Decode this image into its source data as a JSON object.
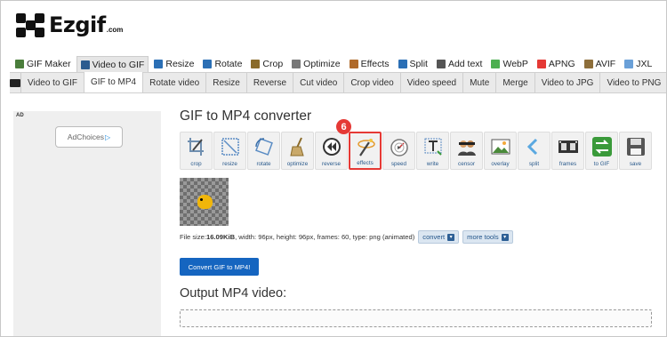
{
  "logo": {
    "name": "Ezgif",
    "domain": ".com"
  },
  "tool_nav": [
    {
      "label": "GIF Maker",
      "icon": "gif-maker-icon",
      "color": "#4a7d3b",
      "active": false
    },
    {
      "label": "Video to GIF",
      "icon": "video-icon",
      "color": "#2b5b8f",
      "active": true
    },
    {
      "label": "Resize",
      "icon": "resize-icon",
      "color": "#2b6fb5",
      "active": false
    },
    {
      "label": "Rotate",
      "icon": "rotate-icon",
      "color": "#2b6fb5",
      "active": false
    },
    {
      "label": "Crop",
      "icon": "crop-icon",
      "color": "#8a6b2a",
      "active": false
    },
    {
      "label": "Optimize",
      "icon": "optimize-icon",
      "color": "#777777",
      "active": false
    },
    {
      "label": "Effects",
      "icon": "effects-icon",
      "color": "#b06a2a",
      "active": false
    },
    {
      "label": "Split",
      "icon": "split-icon",
      "color": "#2b6fb5",
      "active": false
    },
    {
      "label": "Add text",
      "icon": "text-icon",
      "color": "#555555",
      "active": false
    },
    {
      "label": "WebP",
      "icon": "webp-icon",
      "color": "#4caf50",
      "active": false
    },
    {
      "label": "APNG",
      "icon": "apng-icon",
      "color": "#e53935",
      "active": false
    },
    {
      "label": "AVIF",
      "icon": "avif-icon",
      "color": "#8d6e3a",
      "active": false
    },
    {
      "label": "JXL",
      "icon": "jxl-icon",
      "color": "#6aa0d8",
      "active": false
    }
  ],
  "sub_tabs": [
    {
      "label": "Video to GIF",
      "active": false
    },
    {
      "label": "GIF to MP4",
      "active": true
    },
    {
      "label": "Rotate video",
      "active": false
    },
    {
      "label": "Resize",
      "active": false
    },
    {
      "label": "Reverse",
      "active": false
    },
    {
      "label": "Cut video",
      "active": false
    },
    {
      "label": "Crop video",
      "active": false
    },
    {
      "label": "Video speed",
      "active": false
    },
    {
      "label": "Mute",
      "active": false
    },
    {
      "label": "Merge",
      "active": false
    },
    {
      "label": "Video to JPG",
      "active": false
    },
    {
      "label": "Video to PNG",
      "active": false
    }
  ],
  "ad": {
    "label": "AD",
    "choices": "AdChoices",
    "choices_icon": "▷"
  },
  "main": {
    "title": "GIF to MP4 converter",
    "tools": [
      {
        "label": "crop",
        "icon": "crop-icon",
        "highlight": false
      },
      {
        "label": "resize",
        "icon": "resize-icon",
        "highlight": false
      },
      {
        "label": "rotate",
        "icon": "rotate-icon",
        "highlight": false
      },
      {
        "label": "optimize",
        "icon": "broom-icon",
        "highlight": false
      },
      {
        "label": "reverse",
        "icon": "rewind-icon",
        "highlight": false
      },
      {
        "label": "effects",
        "icon": "magic-wand-icon",
        "highlight": true
      },
      {
        "label": "speed",
        "icon": "speedometer-icon",
        "highlight": false
      },
      {
        "label": "write",
        "icon": "text-icon",
        "highlight": false
      },
      {
        "label": "censor",
        "icon": "censor-icon",
        "highlight": false
      },
      {
        "label": "overlay",
        "icon": "picture-icon",
        "highlight": false
      },
      {
        "label": "split",
        "icon": "split-icon",
        "highlight": false
      },
      {
        "label": "frames",
        "icon": "film-strip-icon",
        "highlight": false
      },
      {
        "label": "to GIF",
        "icon": "convert-arrows-icon",
        "highlight": false
      },
      {
        "label": "save",
        "icon": "floppy-disk-icon",
        "highlight": false
      }
    ],
    "step_badge": "6",
    "file_info": {
      "prefix": "File size: ",
      "size": "16.09KiB",
      "details": ", width: 96px, height: 96px, frames: 60, type: png (animated)",
      "convert_label": "convert",
      "more_tools_label": "more tools"
    },
    "convert_button": "Convert GIF to MP4!",
    "output_title": "Output MP4 video:"
  },
  "colors": {
    "accent": "#1565c0",
    "highlight": "#e53935",
    "link": "#2a5a8c"
  }
}
